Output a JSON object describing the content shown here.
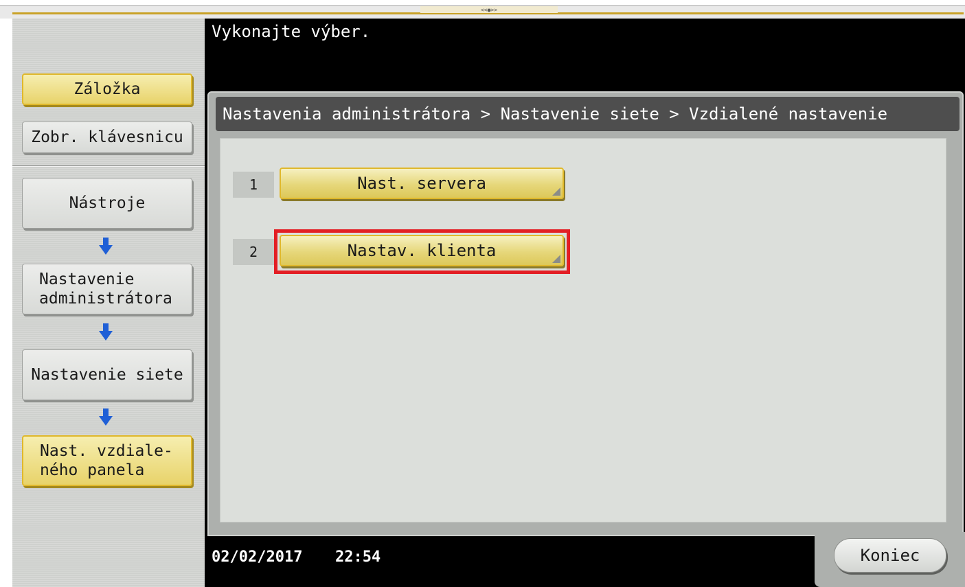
{
  "header": {
    "prompt": "Vykonajte výber.",
    "breadcrumb": "Nastavenia administrátora > Nastavenie siete > Vzdialené nastavenie"
  },
  "sidebar": {
    "bookmark_label": "Záložka",
    "keyboard_label": "Zobr. klávesnicu",
    "path": [
      {
        "line1": "Nástroje",
        "line2": ""
      },
      {
        "line1": "Nastavenie",
        "line2": "administrátora"
      },
      {
        "line1": "Nastavenie siete",
        "line2": ""
      },
      {
        "line1": "Nast. vzdiale-",
        "line2": "ného panela"
      }
    ]
  },
  "options": [
    {
      "number": "1",
      "label": "Nast. servera"
    },
    {
      "number": "2",
      "label": "Nastav. klienta",
      "highlighted": true
    }
  ],
  "footer": {
    "date": "02/02/2017",
    "time": "22:54",
    "end_label": "Koniec"
  },
  "colors": {
    "accent_gold": "#e0b82b",
    "highlight_red": "#e31e24",
    "arrow_blue": "#1f5fd6"
  },
  "icons": [
    "down-arrow-icon",
    "corner-triangle-icon"
  ]
}
